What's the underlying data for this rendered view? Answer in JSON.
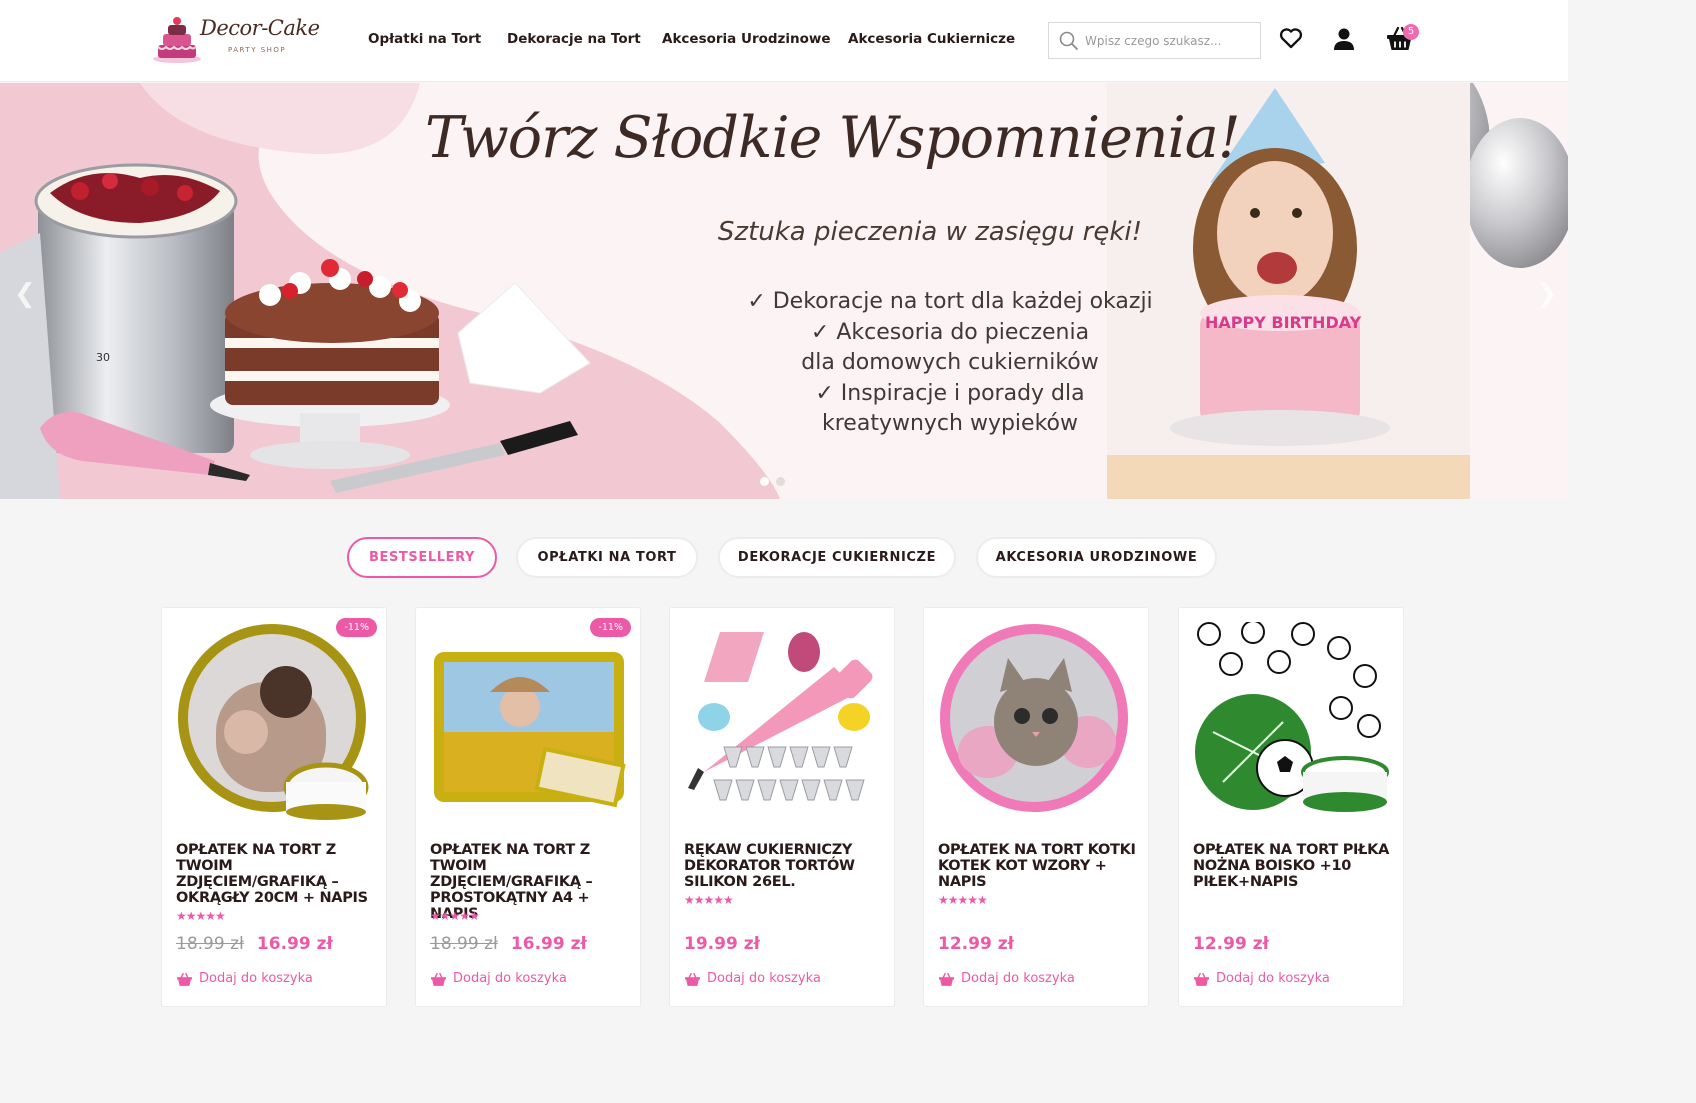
{
  "brand": {
    "name": "Decor-Cake",
    "tagline": "PARTY SHOP"
  },
  "nav": [
    "Opłatki na Tort",
    "Dekoracje na Tort",
    "Akcesoria Urodzinowe",
    "Akcesoria Cukiernicze"
  ],
  "search": {
    "placeholder": "Wpisz czego szukasz..."
  },
  "header_icons": [
    "heart-icon",
    "user-icon",
    "basket-icon"
  ],
  "cart": {
    "count": "5"
  },
  "hero": {
    "title": "Twórz Słodkie Wspomnienia!",
    "subtitle": "Sztuka pieczenia w zasięgu ręki!",
    "points": [
      "✓ Dekoracje na tort dla każdej okazji",
      "✓ Akcesoria do pieczenia",
      "dla domowych cukierników",
      "✓ Inspiracje i porady dla",
      "kreatywnych wypieków"
    ],
    "candle_text": "HAPPY BIRTHDAY",
    "ruler_mark": "30",
    "slides": 2,
    "active_slide": 1
  },
  "tabs": [
    {
      "label": "BESTSELLERY",
      "active": true
    },
    {
      "label": "OPŁATKI NA TORT",
      "active": false
    },
    {
      "label": "DEKORACJE CUKIERNICZE",
      "active": false
    },
    {
      "label": "AKCESORIA URODZINOWE",
      "active": false
    }
  ],
  "products": [
    {
      "title": "OPŁATEK NA TORT Z TWOIM ZDJĘCIEM/GRAFIKĄ – OKRĄGŁY 20CM + NAPIS",
      "badge": "-11%",
      "rating": 5,
      "old_price": "18.99 zł",
      "price": "16.99 zł",
      "add_label": "Dodaj do koszyka"
    },
    {
      "title": "OPŁATEK NA TORT Z TWOIM ZDJĘCIEM/GRAFIKĄ – PROSTOKĄTNY A4 + NAPIS",
      "badge": "-11%",
      "rating": 5,
      "old_price": "18.99 zł",
      "price": "16.99 zł",
      "add_label": "Dodaj do koszyka"
    },
    {
      "title": "RĘKAW CUKIERNICZY DEKORATOR TORTÓW SILIKON 26EL.",
      "badge": "",
      "rating": 5,
      "old_price": "",
      "price": "19.99 zł",
      "add_label": "Dodaj do koszyka"
    },
    {
      "title": "OPŁATEK NA TORT KOTKI KOTEK KOT WZORY + NAPIS",
      "badge": "",
      "rating": 5,
      "old_price": "",
      "price": "12.99 zł",
      "add_label": "Dodaj do koszyka"
    },
    {
      "title": "OPŁATEK NA TORT PIŁKA NOŻNA BOISKO +10 PIŁEK+NAPIS",
      "badge": "",
      "rating": 0,
      "old_price": "",
      "price": "12.99 zł",
      "add_label": "Dodaj do koszyka"
    }
  ],
  "colors": {
    "accent": "#ec5aa6",
    "hero_pink": "#f1c9d4",
    "text_dark": "#2a1a1a"
  }
}
